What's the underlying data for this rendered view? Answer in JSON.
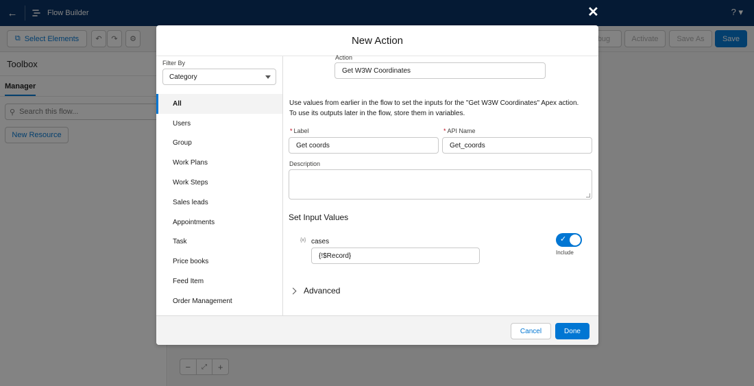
{
  "app": {
    "title": "Flow Builder",
    "help": "?"
  },
  "toolbar": {
    "select_elements": "Select Elements",
    "debug": "bug",
    "activate": "Activate",
    "save_as": "Save As",
    "save": "Save"
  },
  "left_panel": {
    "title": "Toolbox",
    "tab_manager": "Manager",
    "search_placeholder": "Search this flow...",
    "new_resource": "New Resource"
  },
  "modal": {
    "title": "New Action",
    "filter_label": "Filter By",
    "filter_value": "Category",
    "categories": [
      "All",
      "Users",
      "Group",
      "Work Plans",
      "Work Steps",
      "Sales leads",
      "Appointments",
      "Task",
      "Price books",
      "Feed Item",
      "Order Management"
    ],
    "selected_category": "All",
    "action_label": "Action",
    "action_value": "Get W3W Coordinates",
    "help_text": "Use values from earlier in the flow to set the inputs for the \"Get W3W Coordinates\" Apex action. To use its outputs later in the flow, store them in variables.",
    "label_label": "Label",
    "label_value": "Get coords",
    "api_label": "API Name",
    "api_value": "Get_coords",
    "description_label": "Description",
    "required_mark": "*",
    "section_title": "Set Input Values",
    "param_icon": "{x}",
    "param_name": "cases",
    "param_value": "{!$Record}",
    "include_label": "Include",
    "include_on": true,
    "advanced": "Advanced",
    "cancel": "Cancel",
    "done": "Done"
  },
  "colors": {
    "header_bg": "#032d60",
    "brand": "#0176d3",
    "required": "#ba0517"
  }
}
